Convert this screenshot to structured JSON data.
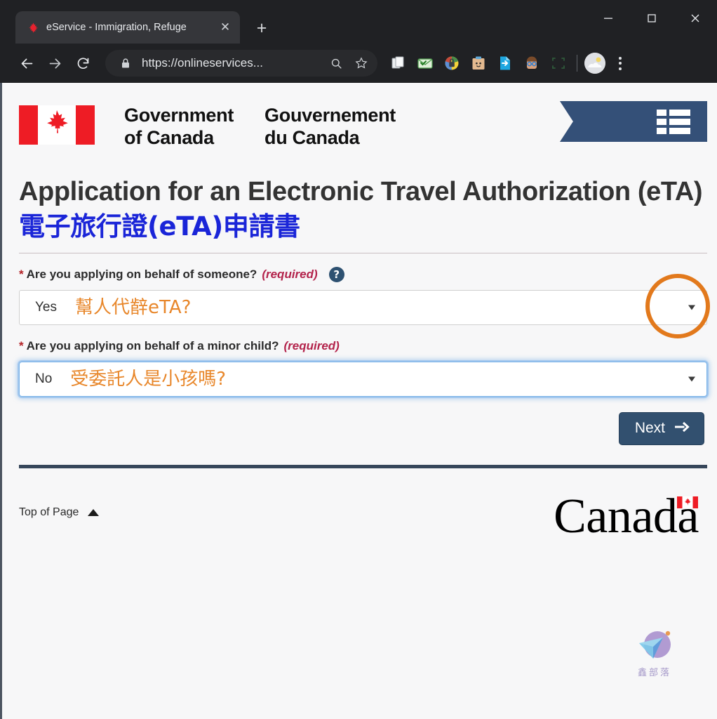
{
  "browser": {
    "tab": {
      "title": "eService - Immigration, Refuge",
      "favicon_name": "maple-leaf-favicon",
      "close_label": "✕"
    },
    "new_tab_label": "+",
    "window_controls": {
      "minimize": "—",
      "maximize": "☐",
      "close": "✕"
    },
    "toolbar": {
      "back": "←",
      "forward": "→",
      "reload": "↻",
      "lock_icon": "lock-icon",
      "url": "https://onlineservices...",
      "search_icon": "⌕",
      "bookmark_icon": "☆",
      "extensions": [
        {
          "name": "copy-documents-extension",
          "glyph": "🗂"
        },
        {
          "name": "mail-checker-extension",
          "glyph": "📩"
        },
        {
          "name": "password-manager-extension",
          "glyph": "🔐"
        },
        {
          "name": "clipboard-bot-extension",
          "glyph": "📷"
        },
        {
          "name": "export-file-extension",
          "glyph": "📄"
        },
        {
          "name": "reader-avatar-extension",
          "glyph": "🧑"
        },
        {
          "name": "screenshot-capture-extension",
          "glyph": "⬚"
        }
      ],
      "profile_avatar": "profile-avatar",
      "menu": "chrome-menu-kebab"
    }
  },
  "site_header": {
    "flag_alt": "canada-flag",
    "wordmark_en_line1": "Government",
    "wordmark_en_line2": "of Canada",
    "wordmark_fr_line1": "Gouvernement",
    "wordmark_fr_line2": "du Canada",
    "menu_ribbon_label": "menu-ribbon"
  },
  "page": {
    "title_en": "Application for an Electronic Travel Authorization (eTA)",
    "title_zh": "電子旅行證(eTA)申請書",
    "questions": [
      {
        "asterisk": "*",
        "label": "Are you applying on behalf of someone?",
        "required": "(required)",
        "help_icon": "?",
        "has_help": true,
        "value": "Yes",
        "annotation_zh": "幫人代辪eTA?",
        "focused": false,
        "circled": true
      },
      {
        "asterisk": "*",
        "label": "Are you applying on behalf of a minor child?",
        "required": "(required)",
        "help_icon": "?",
        "has_help": false,
        "value": "No",
        "annotation_zh": "受委託人是小孩嗎?",
        "focused": true,
        "circled": false
      }
    ],
    "next_button": "Next",
    "next_arrow": "➜"
  },
  "footer": {
    "top_of_page": "Top of Page",
    "canada_wordmark": "Canada"
  },
  "watermark": {
    "text": "鑫部落"
  },
  "colors": {
    "chrome_bg": "#202124",
    "page_bg": "#f7f7f8",
    "goc_navy": "#345078",
    "annotation_orange": "#e8872b",
    "circle_orange": "#e2791c",
    "title_blue": "#1a25d8",
    "required_red": "#b3234b",
    "flag_red": "#ee1c25",
    "button_navy": "#32506f"
  }
}
